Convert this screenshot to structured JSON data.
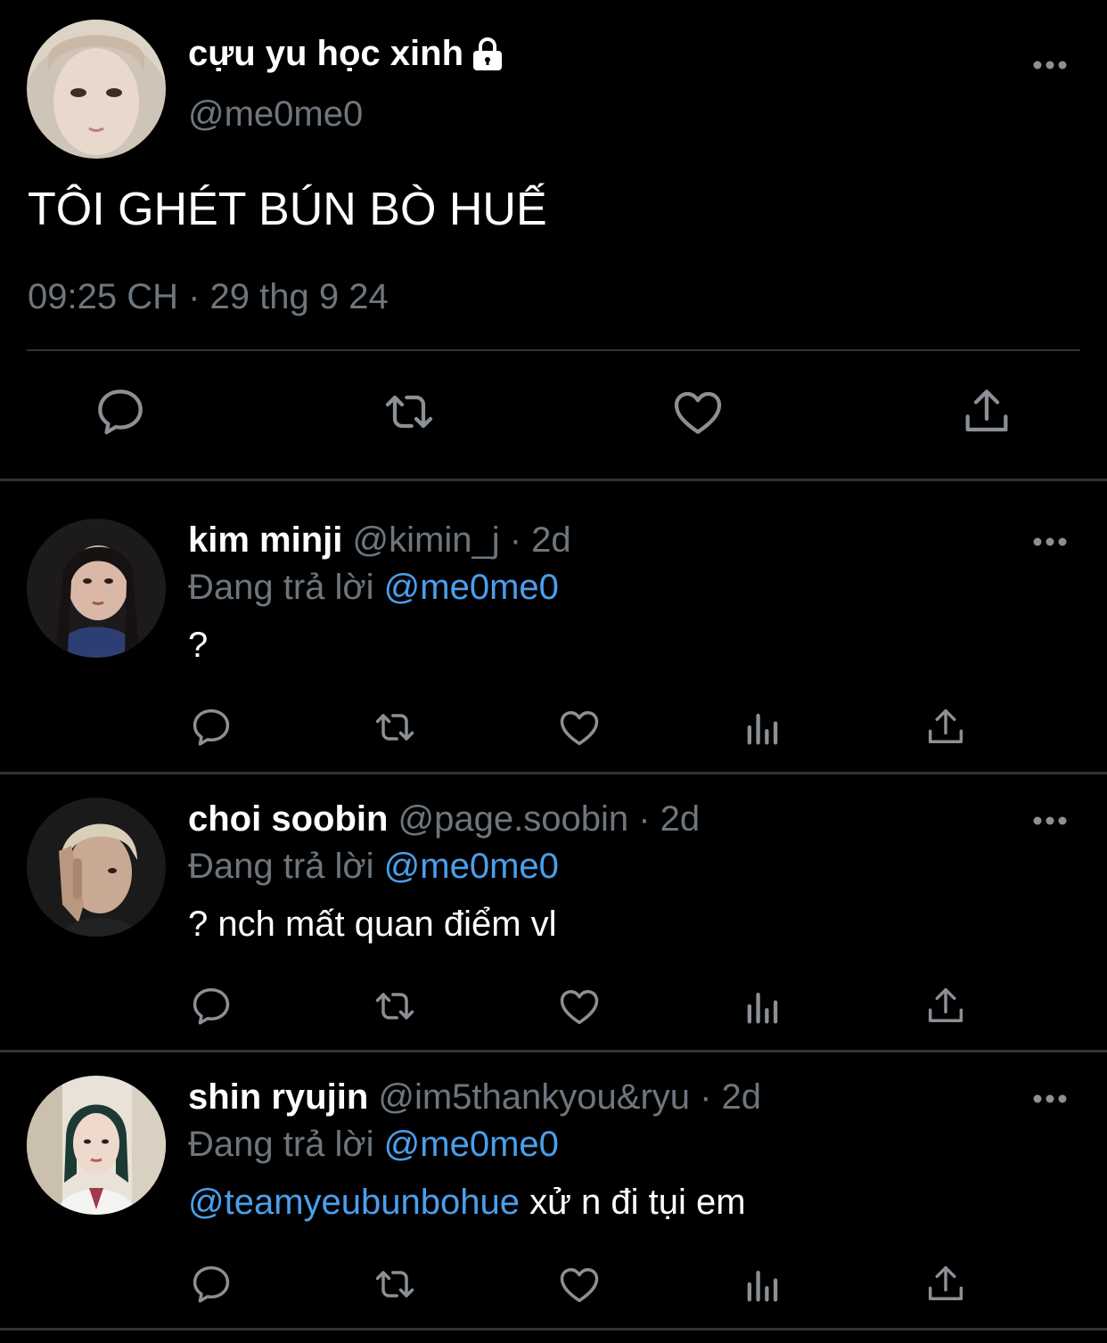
{
  "main_tweet": {
    "display_name": "cựu yu học xinh",
    "handle": "@me0me0",
    "text": "TÔI GHÉT BÚN BÒ HUẾ",
    "timestamp": "09:25 CH · 29 thg 9 24",
    "icons": [
      "lock-icon",
      "more-icon",
      "reply-icon",
      "retweet-icon",
      "like-icon",
      "share-icon"
    ]
  },
  "replies": [
    {
      "display_name": "kim minji",
      "handle_time": " @kimin_j · 2d",
      "replying_label": "Đang trả lời ",
      "replying_to": "@me0me0",
      "body_mention": "",
      "body_text": "?"
    },
    {
      "display_name": "choi soobin",
      "handle_time": " @page.soobin · 2d",
      "replying_label": "Đang trả lời ",
      "replying_to": "@me0me0",
      "body_mention": "",
      "body_text": "? nch mất quan điểm vl"
    },
    {
      "display_name": "shin ryujin",
      "handle_time": " @im5thankyou&ryu · 2d",
      "replying_label": "Đang trả lời ",
      "replying_to": "@me0me0",
      "body_mention": "@teamyeubunbohue",
      "body_text": " xử n đi tụi em"
    }
  ],
  "colors": {
    "background": "#000000",
    "text": "#ffffff",
    "muted": "#6e767d",
    "link": "#4a9fec",
    "divider": "#2f3336"
  }
}
